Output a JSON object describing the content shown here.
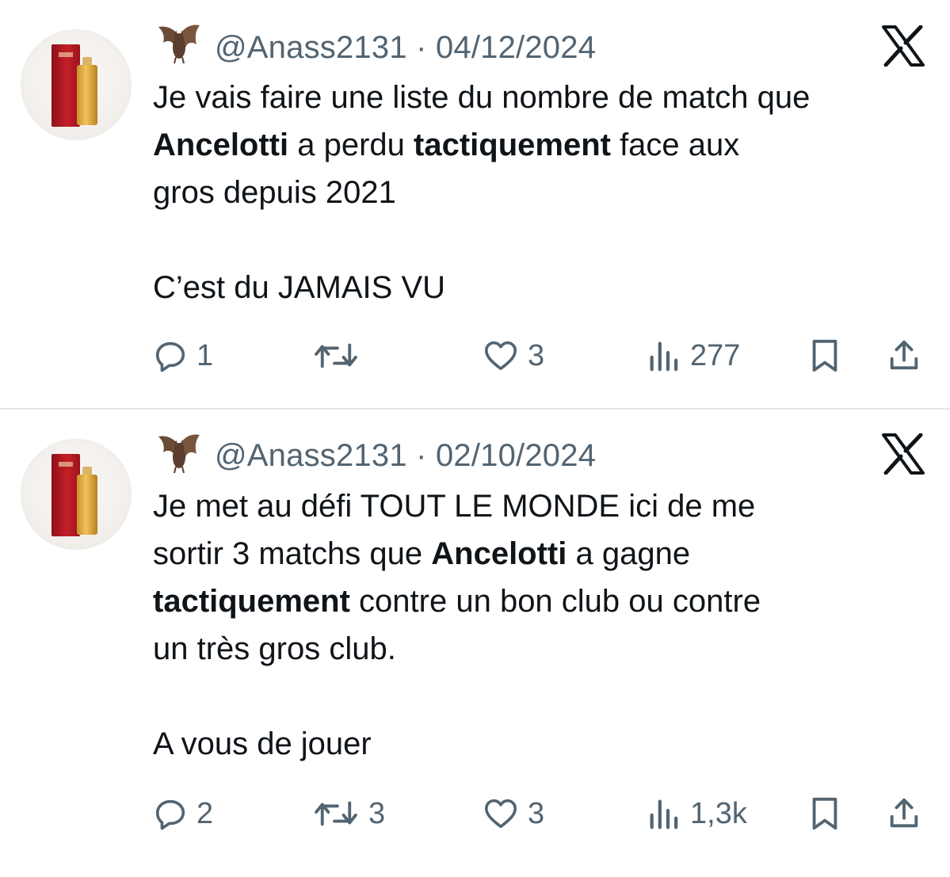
{
  "tweets": [
    {
      "handle": "@Anass2131",
      "separator": "·",
      "date": "04/12/2024",
      "text_parts": [
        {
          "text": "Je vais faire une liste du nombre de match que\n",
          "bold": false
        },
        {
          "text": "Ancelotti",
          "bold": true
        },
        {
          "text": " a perdu ",
          "bold": false
        },
        {
          "text": "tactiquement",
          "bold": true
        },
        {
          "text": " face aux\ngros depuis 2021\n\nC’est du JAMAIS VU",
          "bold": false
        }
      ],
      "replies": "1",
      "retweets": "",
      "likes": "3",
      "views": "277"
    },
    {
      "handle": "@Anass2131",
      "separator": "·",
      "date": "02/10/2024",
      "text_parts": [
        {
          "text": "Je met au défi TOUT LE MONDE ici de me\nsortir 3 matchs que ",
          "bold": false
        },
        {
          "text": "Ancelotti",
          "bold": true
        },
        {
          "text": " a gagne\n",
          "bold": false
        },
        {
          "text": "tactiquement",
          "bold": true
        },
        {
          "text": " contre un bon club ou contre\nun très gros club.\n\nA vous de jouer",
          "bold": false
        }
      ],
      "replies": "2",
      "retweets": "3",
      "likes": "3",
      "views": "1,3k"
    }
  ],
  "icons": {
    "reply": "reply-icon",
    "retweet": "retweet-icon",
    "like": "heart-icon",
    "views": "views-icon",
    "bookmark": "bookmark-icon",
    "share": "share-icon",
    "platform": "x-logo-icon",
    "emoji": "bat-icon"
  },
  "colors": {
    "text": "#0f1419",
    "muted": "#536471",
    "divider": "#e6e6e6"
  }
}
